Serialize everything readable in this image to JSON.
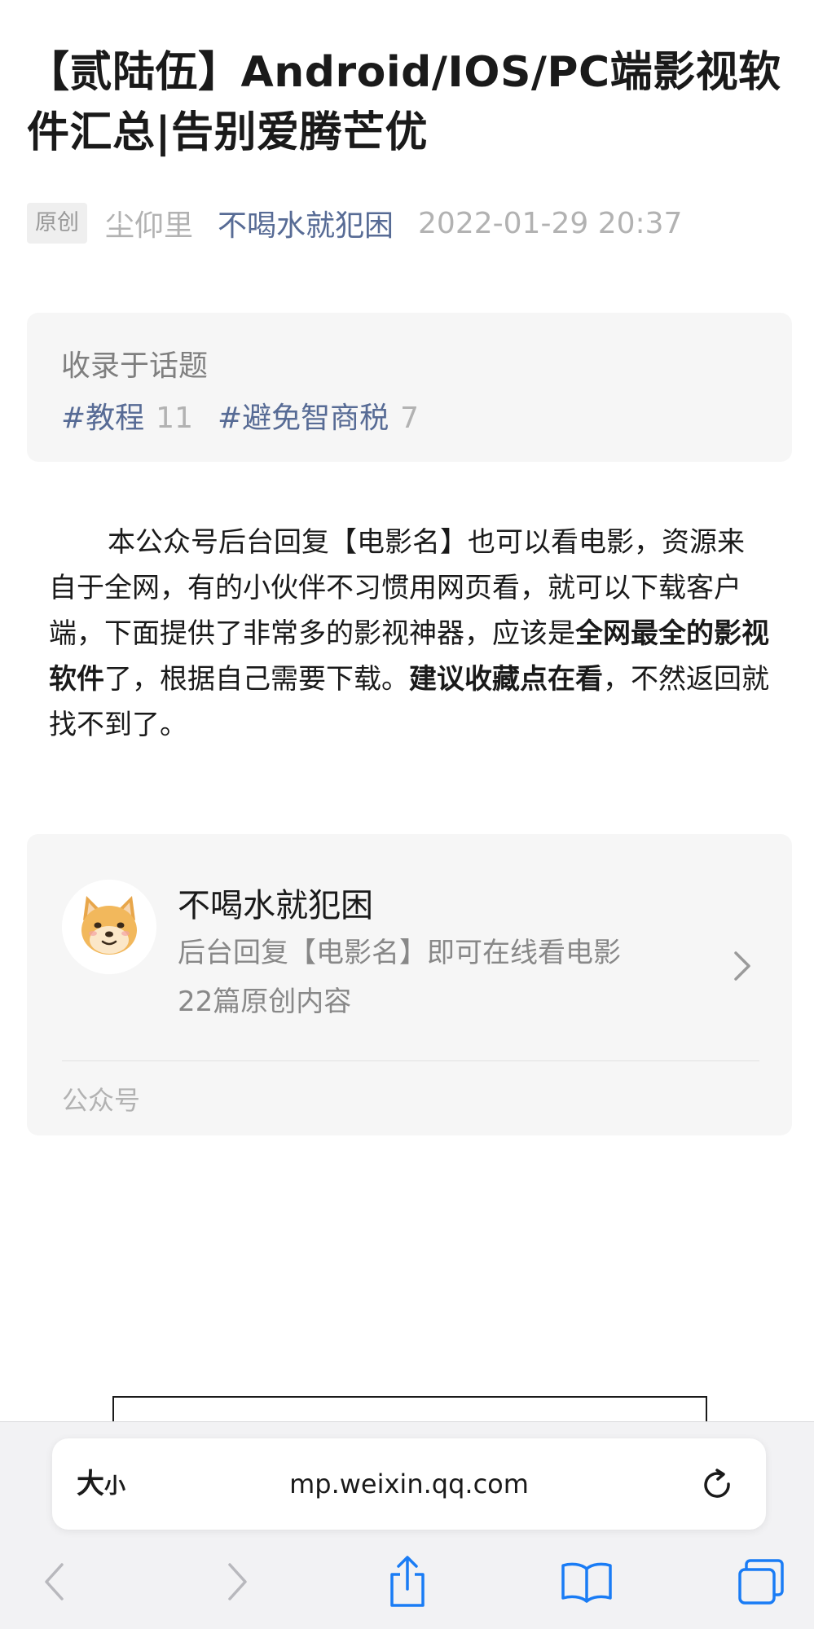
{
  "article": {
    "title": "【贰陆伍】Android/IOS/PC端影视软件汇总|告别爱腾芒优",
    "original_badge": "原创",
    "author": "尘仰里",
    "account_name": "不喝水就犯困",
    "date": "2022-01-29 20:37"
  },
  "topics": {
    "heading": "收录于话题",
    "tags": [
      {
        "label": "#教程",
        "count": "11"
      },
      {
        "label": "#避免智商税",
        "count": "7"
      }
    ]
  },
  "body": {
    "p1": "本公众号后台回复【电影名】也可以看电影，资源来自于全网，有的小伙伴不习惯用网页看，就可以下载客户端，下面提供了非常多的影视神器，应该是",
    "p1_bold": "全网最全的影视软件",
    "p2": "了，根据自己需要下载。",
    "p2_bold": "建议收藏点在看",
    "p3": "，不然返回就找不到了。"
  },
  "account_card": {
    "name": "不喝水就犯困",
    "description": "后台回复【电影名】即可在线看电影",
    "post_count": "22篇原创内容",
    "type_label": "公众号",
    "avatar_icon": "shiba-dog-avatar-icon"
  },
  "browser": {
    "text_size_large": "大",
    "text_size_small": "小",
    "url": "mp.weixin.qq.com",
    "accent_color": "#1a7cf5"
  },
  "colors": {
    "link": "#576b95",
    "muted": "#b2b2b2",
    "card_bg": "#f6f6f6"
  }
}
